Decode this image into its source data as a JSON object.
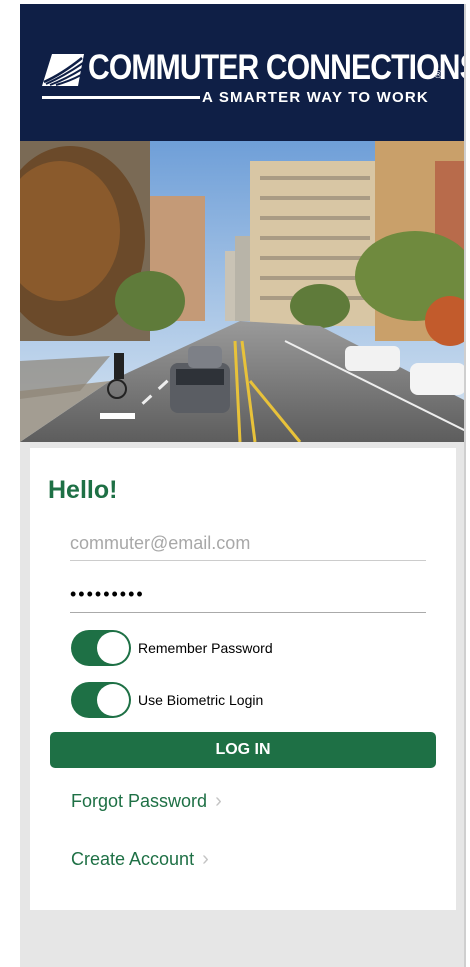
{
  "brand": {
    "title": "COMMUTER CONNECTIONS",
    "registered": "®",
    "tagline": "A SMARTER WAY TO WORK"
  },
  "login": {
    "greeting": "Hello!",
    "email_placeholder": "commuter@email.com",
    "password_masked": "•••••••••",
    "remember_label": "Remember Password",
    "remember_on": true,
    "biometric_label": "Use Biometric Login",
    "biometric_on": true,
    "login_button": "LOG IN"
  },
  "links": {
    "forgot": "Forgot Password",
    "create": "Create Account"
  },
  "colors": {
    "header_bg": "#0f1f46",
    "accent_green": "#1e7045"
  }
}
